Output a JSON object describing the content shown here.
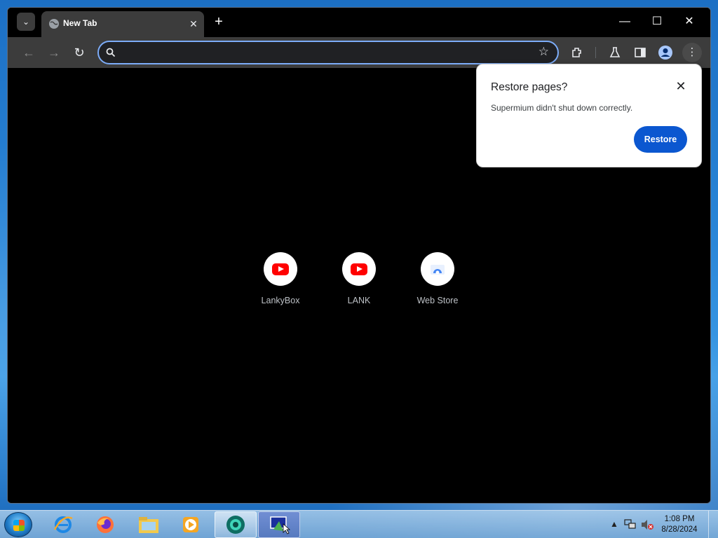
{
  "browser": {
    "tab": {
      "title": "New Tab"
    },
    "new_tab_label": "+",
    "window_controls": {
      "minimize": "—",
      "maximize": "☐",
      "close": "✕"
    },
    "omnibox": {
      "value": "",
      "placeholder": ""
    },
    "accent": "#7cacf8"
  },
  "shortcuts": [
    {
      "label": "LankyBox",
      "icon": "youtube-icon"
    },
    {
      "label": "LANK",
      "icon": "youtube-icon"
    },
    {
      "label": "Web Store",
      "icon": "web-store-icon"
    }
  ],
  "restore_popup": {
    "title": "Restore pages?",
    "message": "Supermium didn't shut down correctly.",
    "button": "Restore",
    "button_color": "#0b57d0"
  },
  "taskbar": {
    "apps": [
      "internet-explorer-icon",
      "firefox-icon",
      "file-explorer-icon",
      "media-player-icon",
      "browser-app-icon",
      "remote-app-icon"
    ],
    "clock": {
      "time": "1:08 PM",
      "date": "8/28/2024"
    }
  }
}
